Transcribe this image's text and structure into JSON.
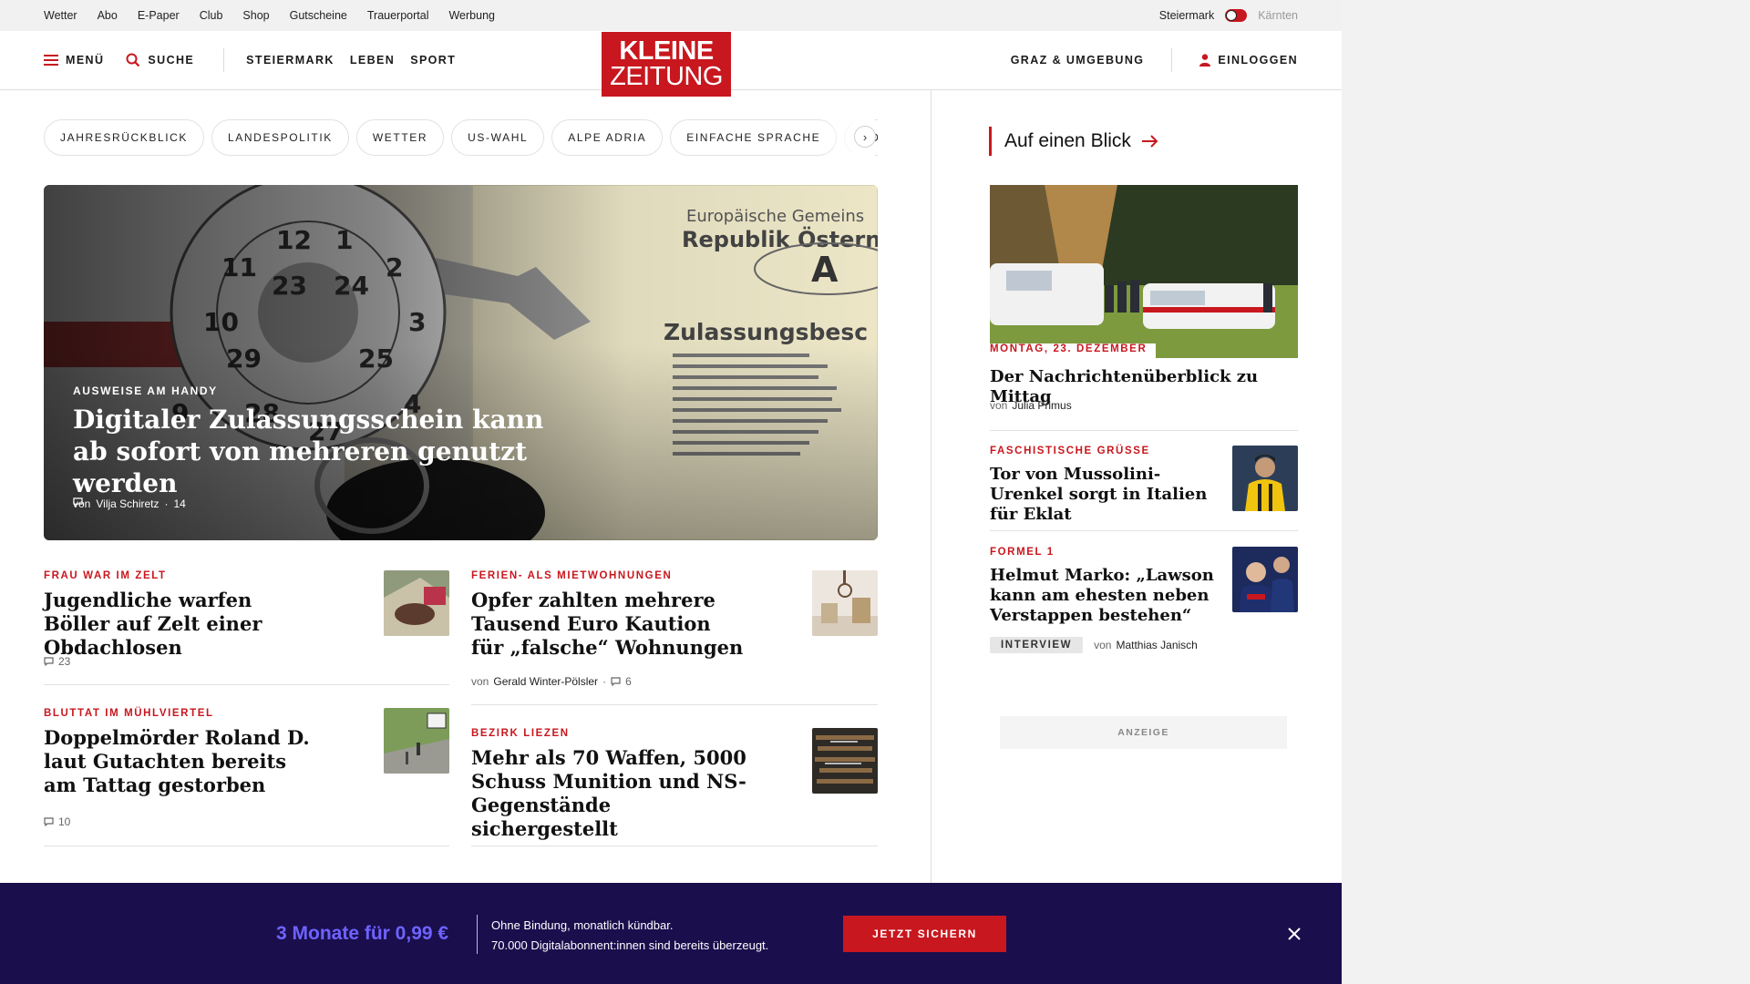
{
  "utility": {
    "links": [
      "Wetter",
      "Abo",
      "E-Paper",
      "Club",
      "Shop",
      "Gutscheine",
      "Trauerportal",
      "Werbung"
    ],
    "region_left": "Steiermark",
    "region_right": "Kärnten"
  },
  "header": {
    "menu_label": "MENÜ",
    "search_label": "SUCHE",
    "sections": [
      "STEIERMARK",
      "LEBEN",
      "SPORT"
    ],
    "logo_line1": "KLEINE",
    "logo_line2": "ZEITUNG",
    "region_nav": "GRAZ & UMGEBUNG",
    "login_label": "EINLOGGEN"
  },
  "topics": [
    "JAHRESRÜCKBLICK",
    "LANDESPOLITIK",
    "WETTER",
    "US-WAHL",
    "ALPE ADRIA",
    "EINFACHE SPRACHE",
    "DOSSIER"
  ],
  "hero": {
    "kicker": "AUSWEISE AM HANDY",
    "title": "Digitaler Zulassungsschein kann ab sofort von mehreren genutzt werden",
    "by": "von",
    "author": "Vilja Schiretz",
    "comments": "14"
  },
  "articles": [
    {
      "kicker": "FRAU WAR IM ZELT",
      "title": "Jugendliche warfen Böller auf Zelt einer Obdachlosen",
      "comments": "23"
    },
    {
      "kicker": "FERIEN- ALS MIETWOHNUNGEN",
      "title": "Opfer zahlten mehrere Tausend Euro Kaution für „falsche“ Wohnungen",
      "by": "von",
      "author": "Gerald Winter-Pölsler",
      "comments": "6"
    },
    {
      "kicker": "BLUTTAT IM MÜHLVIERTEL",
      "title": "Doppelmörder Roland D. laut Gutachten bereits am Tattag gestorben",
      "comments": "10"
    },
    {
      "kicker": "BEZIRK LIEZEN",
      "title": "Mehr als 70 Waffen, 5000 Schuss Munition und NS-Gegenstände sichergestellt"
    }
  ],
  "sidebar": {
    "heading": "Auf einen Blick",
    "lead": {
      "date": "MONTAG, 23. DEZEMBER",
      "title": "Der Nachrichtenüberblick zu Mittag",
      "by": "von",
      "author": "Julia Primus"
    },
    "items": [
      {
        "kicker": "FASCHISTISCHE GRÜSSE",
        "title": "Tor von Mussolini-Urenkel sorgt in Italien für Eklat"
      },
      {
        "kicker": "FORMEL 1",
        "title": "Helmut Marko: „Lawson kann am ehesten neben Verstappen bestehen“",
        "badge": "INTERVIEW",
        "by": "von",
        "author": "Matthias Janisch"
      }
    ],
    "ad_label": "ANZEIGE"
  },
  "promo": {
    "price": "3 Monate für 0,99 €",
    "line1": "Ohne Bindung, monatlich kündbar.",
    "line2": "70.000 Digitalabonnent:innen sind bereits überzeugt.",
    "cta": "JETZT SICHERN"
  },
  "colors": {
    "brand_red": "#c8171e",
    "promo_bg": "#1a0e4d",
    "promo_price": "#6e63ff"
  }
}
